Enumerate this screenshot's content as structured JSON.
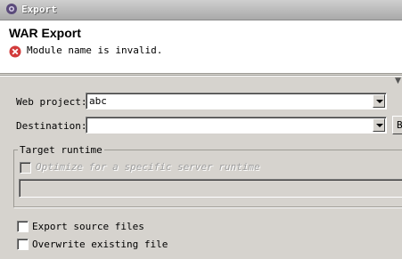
{
  "window": {
    "title": "Export",
    "icon": "eclipse-gear-icon"
  },
  "banner": {
    "title": "WAR Export",
    "message": "Module name is invalid.",
    "message_icon": "error-icon"
  },
  "form": {
    "web_project": {
      "label": "Web project:",
      "value": "abc"
    },
    "destination": {
      "label": "Destination:",
      "value": "",
      "browse_label": "B"
    },
    "target_runtime": {
      "group_label": "Target runtime",
      "optimize_label": "Optimize for a specific server runtime",
      "runtime_value": ""
    },
    "export_source": {
      "label": "Export source files",
      "checked": false
    },
    "overwrite": {
      "label": "Overwrite existing file",
      "checked": false
    }
  }
}
